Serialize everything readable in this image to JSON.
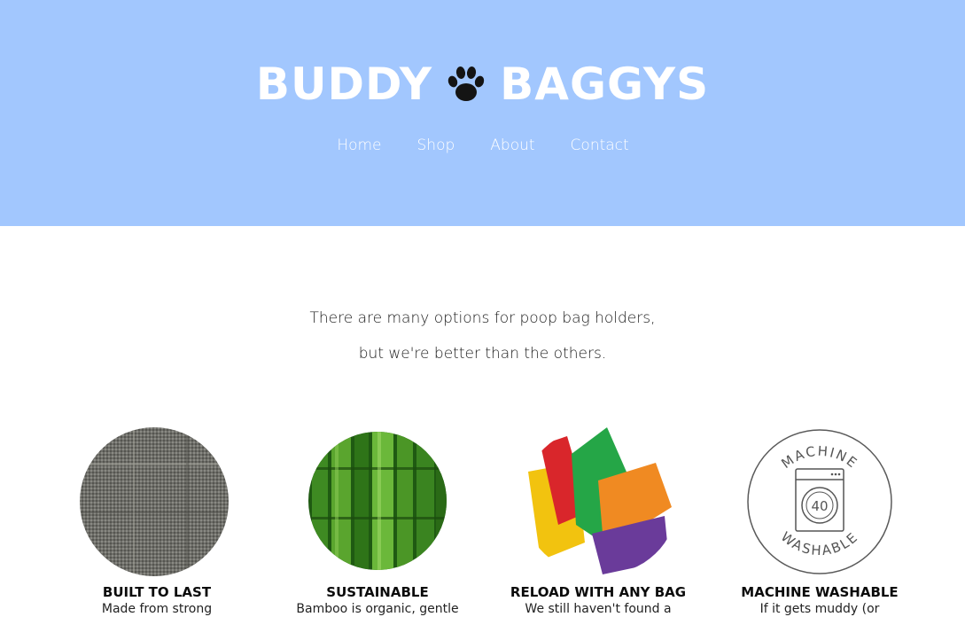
{
  "brand": {
    "word_left": "BUDDY",
    "word_right": "BAGGYS",
    "logo_icon": "paw-print-icon"
  },
  "nav": {
    "items": [
      {
        "label": "Home"
      },
      {
        "label": "Shop"
      },
      {
        "label": "About"
      },
      {
        "label": "Contact"
      }
    ]
  },
  "intro": {
    "line1": "There are many options for poop bag holders,",
    "line2": "but we're better than the others."
  },
  "features": [
    {
      "title": "BUILT TO LAST",
      "text": "Made from strong",
      "image": "fabric-texture-image"
    },
    {
      "title": "SUSTAINABLE",
      "text": "Bamboo is organic, gentle",
      "image": "bamboo-image"
    },
    {
      "title": "RELOAD WITH ANY BAG",
      "text": "We still haven't found a",
      "image": "colored-bags-image"
    },
    {
      "title": "MACHINE WASHABLE",
      "text": "If it gets muddy (or",
      "image": "machine-washable-badge",
      "badge_top": "MACHINE",
      "badge_bottom": "WASHABLE",
      "badge_number": "40"
    }
  ],
  "colors": {
    "header_bg": "#a2c7fe",
    "text": "#1b1b1b",
    "white": "#ffffff"
  }
}
